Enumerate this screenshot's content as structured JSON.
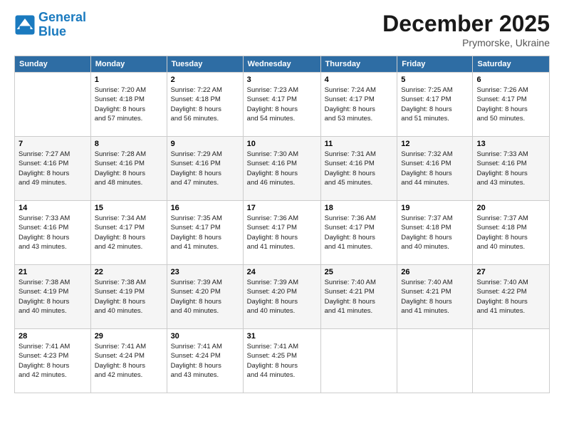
{
  "header": {
    "logo_line1": "General",
    "logo_line2": "Blue",
    "month": "December 2025",
    "location": "Prymorske, Ukraine"
  },
  "weekdays": [
    "Sunday",
    "Monday",
    "Tuesday",
    "Wednesday",
    "Thursday",
    "Friday",
    "Saturday"
  ],
  "weeks": [
    [
      {
        "day": "",
        "info": ""
      },
      {
        "day": "1",
        "info": "Sunrise: 7:20 AM\nSunset: 4:18 PM\nDaylight: 8 hours\nand 57 minutes."
      },
      {
        "day": "2",
        "info": "Sunrise: 7:22 AM\nSunset: 4:18 PM\nDaylight: 8 hours\nand 56 minutes."
      },
      {
        "day": "3",
        "info": "Sunrise: 7:23 AM\nSunset: 4:17 PM\nDaylight: 8 hours\nand 54 minutes."
      },
      {
        "day": "4",
        "info": "Sunrise: 7:24 AM\nSunset: 4:17 PM\nDaylight: 8 hours\nand 53 minutes."
      },
      {
        "day": "5",
        "info": "Sunrise: 7:25 AM\nSunset: 4:17 PM\nDaylight: 8 hours\nand 51 minutes."
      },
      {
        "day": "6",
        "info": "Sunrise: 7:26 AM\nSunset: 4:17 PM\nDaylight: 8 hours\nand 50 minutes."
      }
    ],
    [
      {
        "day": "7",
        "info": "Sunrise: 7:27 AM\nSunset: 4:16 PM\nDaylight: 8 hours\nand 49 minutes."
      },
      {
        "day": "8",
        "info": "Sunrise: 7:28 AM\nSunset: 4:16 PM\nDaylight: 8 hours\nand 48 minutes."
      },
      {
        "day": "9",
        "info": "Sunrise: 7:29 AM\nSunset: 4:16 PM\nDaylight: 8 hours\nand 47 minutes."
      },
      {
        "day": "10",
        "info": "Sunrise: 7:30 AM\nSunset: 4:16 PM\nDaylight: 8 hours\nand 46 minutes."
      },
      {
        "day": "11",
        "info": "Sunrise: 7:31 AM\nSunset: 4:16 PM\nDaylight: 8 hours\nand 45 minutes."
      },
      {
        "day": "12",
        "info": "Sunrise: 7:32 AM\nSunset: 4:16 PM\nDaylight: 8 hours\nand 44 minutes."
      },
      {
        "day": "13",
        "info": "Sunrise: 7:33 AM\nSunset: 4:16 PM\nDaylight: 8 hours\nand 43 minutes."
      }
    ],
    [
      {
        "day": "14",
        "info": "Sunrise: 7:33 AM\nSunset: 4:16 PM\nDaylight: 8 hours\nand 43 minutes."
      },
      {
        "day": "15",
        "info": "Sunrise: 7:34 AM\nSunset: 4:17 PM\nDaylight: 8 hours\nand 42 minutes."
      },
      {
        "day": "16",
        "info": "Sunrise: 7:35 AM\nSunset: 4:17 PM\nDaylight: 8 hours\nand 41 minutes."
      },
      {
        "day": "17",
        "info": "Sunrise: 7:36 AM\nSunset: 4:17 PM\nDaylight: 8 hours\nand 41 minutes."
      },
      {
        "day": "18",
        "info": "Sunrise: 7:36 AM\nSunset: 4:17 PM\nDaylight: 8 hours\nand 41 minutes."
      },
      {
        "day": "19",
        "info": "Sunrise: 7:37 AM\nSunset: 4:18 PM\nDaylight: 8 hours\nand 40 minutes."
      },
      {
        "day": "20",
        "info": "Sunrise: 7:37 AM\nSunset: 4:18 PM\nDaylight: 8 hours\nand 40 minutes."
      }
    ],
    [
      {
        "day": "21",
        "info": "Sunrise: 7:38 AM\nSunset: 4:19 PM\nDaylight: 8 hours\nand 40 minutes."
      },
      {
        "day": "22",
        "info": "Sunrise: 7:38 AM\nSunset: 4:19 PM\nDaylight: 8 hours\nand 40 minutes."
      },
      {
        "day": "23",
        "info": "Sunrise: 7:39 AM\nSunset: 4:20 PM\nDaylight: 8 hours\nand 40 minutes."
      },
      {
        "day": "24",
        "info": "Sunrise: 7:39 AM\nSunset: 4:20 PM\nDaylight: 8 hours\nand 40 minutes."
      },
      {
        "day": "25",
        "info": "Sunrise: 7:40 AM\nSunset: 4:21 PM\nDaylight: 8 hours\nand 41 minutes."
      },
      {
        "day": "26",
        "info": "Sunrise: 7:40 AM\nSunset: 4:21 PM\nDaylight: 8 hours\nand 41 minutes."
      },
      {
        "day": "27",
        "info": "Sunrise: 7:40 AM\nSunset: 4:22 PM\nDaylight: 8 hours\nand 41 minutes."
      }
    ],
    [
      {
        "day": "28",
        "info": "Sunrise: 7:41 AM\nSunset: 4:23 PM\nDaylight: 8 hours\nand 42 minutes."
      },
      {
        "day": "29",
        "info": "Sunrise: 7:41 AM\nSunset: 4:24 PM\nDaylight: 8 hours\nand 42 minutes."
      },
      {
        "day": "30",
        "info": "Sunrise: 7:41 AM\nSunset: 4:24 PM\nDaylight: 8 hours\nand 43 minutes."
      },
      {
        "day": "31",
        "info": "Sunrise: 7:41 AM\nSunset: 4:25 PM\nDaylight: 8 hours\nand 44 minutes."
      },
      {
        "day": "",
        "info": ""
      },
      {
        "day": "",
        "info": ""
      },
      {
        "day": "",
        "info": ""
      }
    ]
  ]
}
